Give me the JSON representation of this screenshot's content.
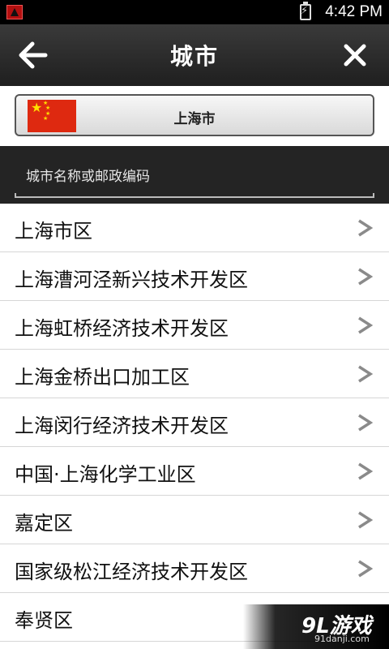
{
  "status_bar": {
    "time": "4:42 PM",
    "icons": [
      "app-notification-icon",
      "battery-charging-icon"
    ]
  },
  "title_bar": {
    "title": "城市",
    "back_icon": "arrow-left-icon",
    "close_icon": "close-icon"
  },
  "country": {
    "name": "上海市",
    "flag_icon": "china-flag-icon"
  },
  "search": {
    "placeholder": "城市名称或邮政编码",
    "value": ""
  },
  "list": {
    "chevron_icon": "chevron-right-icon",
    "items": [
      {
        "label": "上海市区"
      },
      {
        "label": "上海漕河泾新兴技术开发区"
      },
      {
        "label": "上海虹桥经济技术开发区"
      },
      {
        "label": "上海金桥出口加工区"
      },
      {
        "label": "上海闵行经济技术开发区"
      },
      {
        "label": "中国·上海化学工业区"
      },
      {
        "label": "嘉定区"
      },
      {
        "label": "国家级松江经济技术开发区"
      },
      {
        "label": "奉贤区"
      }
    ]
  },
  "watermark": {
    "logo": "9L游戏",
    "url": "91danji.com"
  },
  "colors": {
    "status_bar_bg": "#000000",
    "title_bar_bg": "#2b2b2b",
    "search_bg": "#242424",
    "flag_red": "#de2910",
    "flag_yellow": "#ffde00",
    "chevron": "#8a8a8a"
  }
}
